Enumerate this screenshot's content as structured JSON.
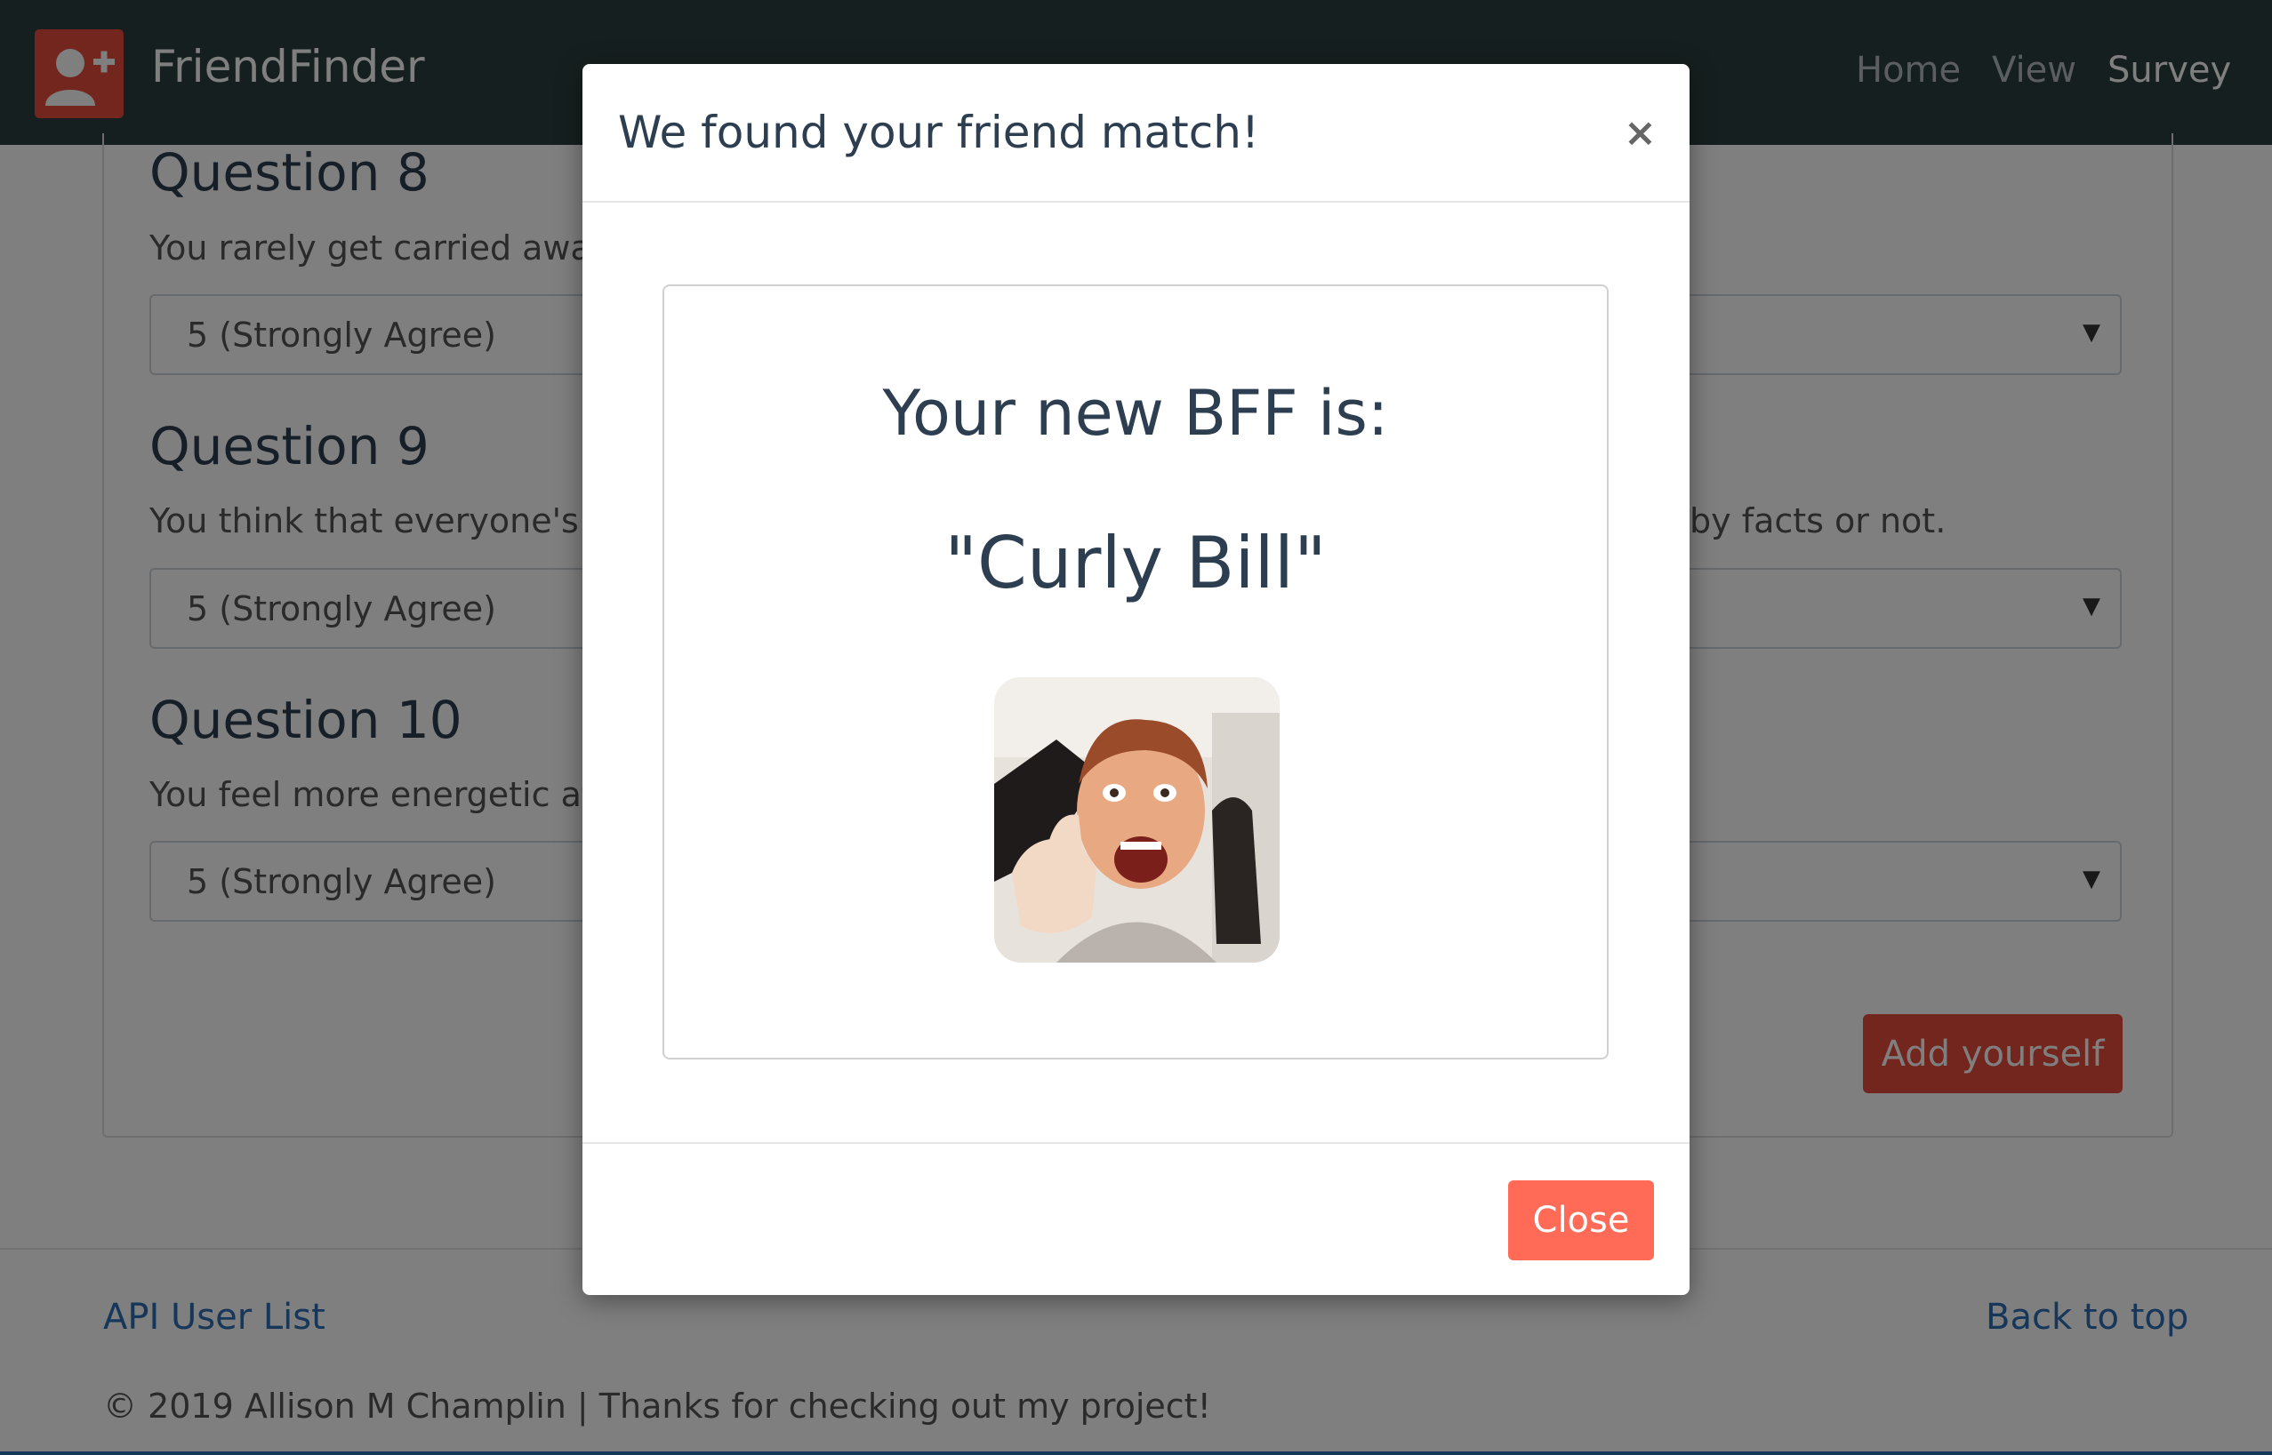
{
  "navbar": {
    "brand": "FriendFinder",
    "links": [
      {
        "label": "Home"
      },
      {
        "label": "View"
      },
      {
        "label": "Survey"
      }
    ]
  },
  "survey": {
    "questions": [
      {
        "title": "Question 8",
        "text": "You rarely get carried away",
        "selected": "5 (Strongly Agree)"
      },
      {
        "title": "Question 9",
        "text": "You think that everyone's v",
        "text_end": "by facts or not.",
        "selected": "5 (Strongly Agree)"
      },
      {
        "title": "Question 10",
        "text": "You feel more energetic aft",
        "selected": "5 (Strongly Agree)"
      }
    ],
    "submit_label": "Add yourself"
  },
  "footer": {
    "api_link": "API User List",
    "top_link": "Back to top",
    "copyright": "© 2019 Allison M Champlin | Thanks for checking out my project!"
  },
  "modal": {
    "title": "We found your friend match!",
    "close_x": "×",
    "bff_label": "Your new BFF is:",
    "bff_name": "\"Curly Bill\"",
    "close_label": "Close"
  },
  "colors": {
    "navbar": "#2c3e3f",
    "accent_red": "#e74c3c",
    "close_button": "#ff6b57",
    "link_blue": "#2c6fb5"
  },
  "icons": [
    "add-user-icon",
    "caret-down-icon",
    "close-icon"
  ]
}
